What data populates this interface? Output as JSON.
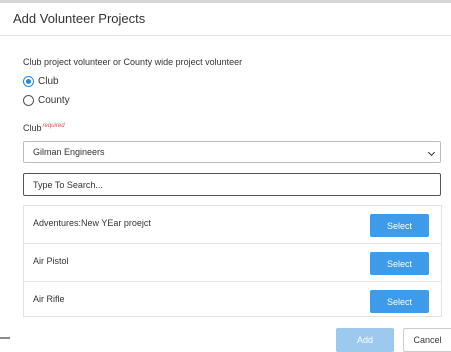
{
  "dialog": {
    "title": "Add Volunteer Projects"
  },
  "volunteer_type": {
    "label": "Club project volunteer or County wide project volunteer",
    "options": [
      {
        "label": "Club",
        "selected": true
      },
      {
        "label": "County",
        "selected": false
      }
    ]
  },
  "club": {
    "label": "Club",
    "required_tag": "required",
    "selected_value": "Gilman Engineers"
  },
  "search": {
    "placeholder": "Type To Search..."
  },
  "projects": {
    "select_label": "Select",
    "items": [
      {
        "label": "Adventures:New YEar proejct"
      },
      {
        "label": "Air Pistol"
      },
      {
        "label": "Air Rifle"
      }
    ]
  },
  "footer": {
    "add_label": "Add",
    "cancel_label": "Cancel"
  },
  "colors": {
    "primary": "#3d9be9",
    "primary_disabled": "#9ec9ef",
    "radio_accent": "#1e88e5",
    "required": "#d9534f"
  }
}
